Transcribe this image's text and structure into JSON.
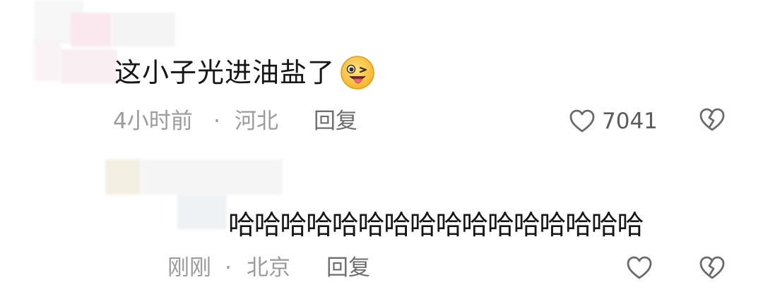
{
  "comments": [
    {
      "text": "这小子光进油盐了",
      "emoji": "winking-tongue-emoji",
      "time": "4小时前",
      "separator": "·",
      "location": "河北",
      "reply_label": "回复",
      "like_count": "7041"
    },
    {
      "text": "哈哈哈哈哈哈哈哈哈哈哈哈哈哈哈哈",
      "time": "刚刚",
      "separator": "·",
      "location": "北京",
      "reply_label": "回复",
      "like_count": ""
    }
  ],
  "icons": {
    "like": "heart-outline-icon",
    "dislike": "broken-heart-icon"
  },
  "colors": {
    "meta_text": "#9b9b9b",
    "reply_text": "#6e6e6e",
    "main_text": "#161616"
  }
}
